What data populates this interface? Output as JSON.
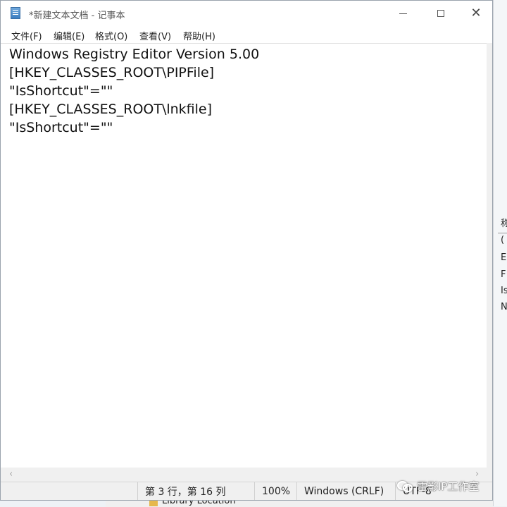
{
  "window": {
    "title": "*新建文本文档 - 记事本"
  },
  "menu": {
    "items": [
      {
        "label": "文件(F)"
      },
      {
        "label": "编辑(E)"
      },
      {
        "label": "格式(O)"
      },
      {
        "label": "查看(V)"
      },
      {
        "label": "帮助(H)"
      }
    ]
  },
  "editor": {
    "lines": [
      "Windows Registry Editor Version 5.00",
      "[HKEY_CLASSES_ROOT\\PIPFile]",
      "\"IsShortcut\"=\"\"",
      "[HKEY_CLASSES_ROOT\\lnkfile]",
      "\"IsShortcut\"=\"\""
    ]
  },
  "statusbar": {
    "position": "第 3 行，第 16 列",
    "zoom": "100%",
    "line_ending": "Windows (CRLF)",
    "encoding": "UTF-8"
  },
  "watermark": {
    "text": "雷影IP工作室"
  },
  "background": {
    "right_chars": [
      "称",
      "(",
      "E",
      "F",
      "Is",
      "N"
    ],
    "bottom_tree_label": "Library Location"
  },
  "icons": {
    "app": "notepad-icon",
    "minimize": "minimize-icon",
    "maximize": "maximize-icon",
    "close": "close-icon"
  }
}
